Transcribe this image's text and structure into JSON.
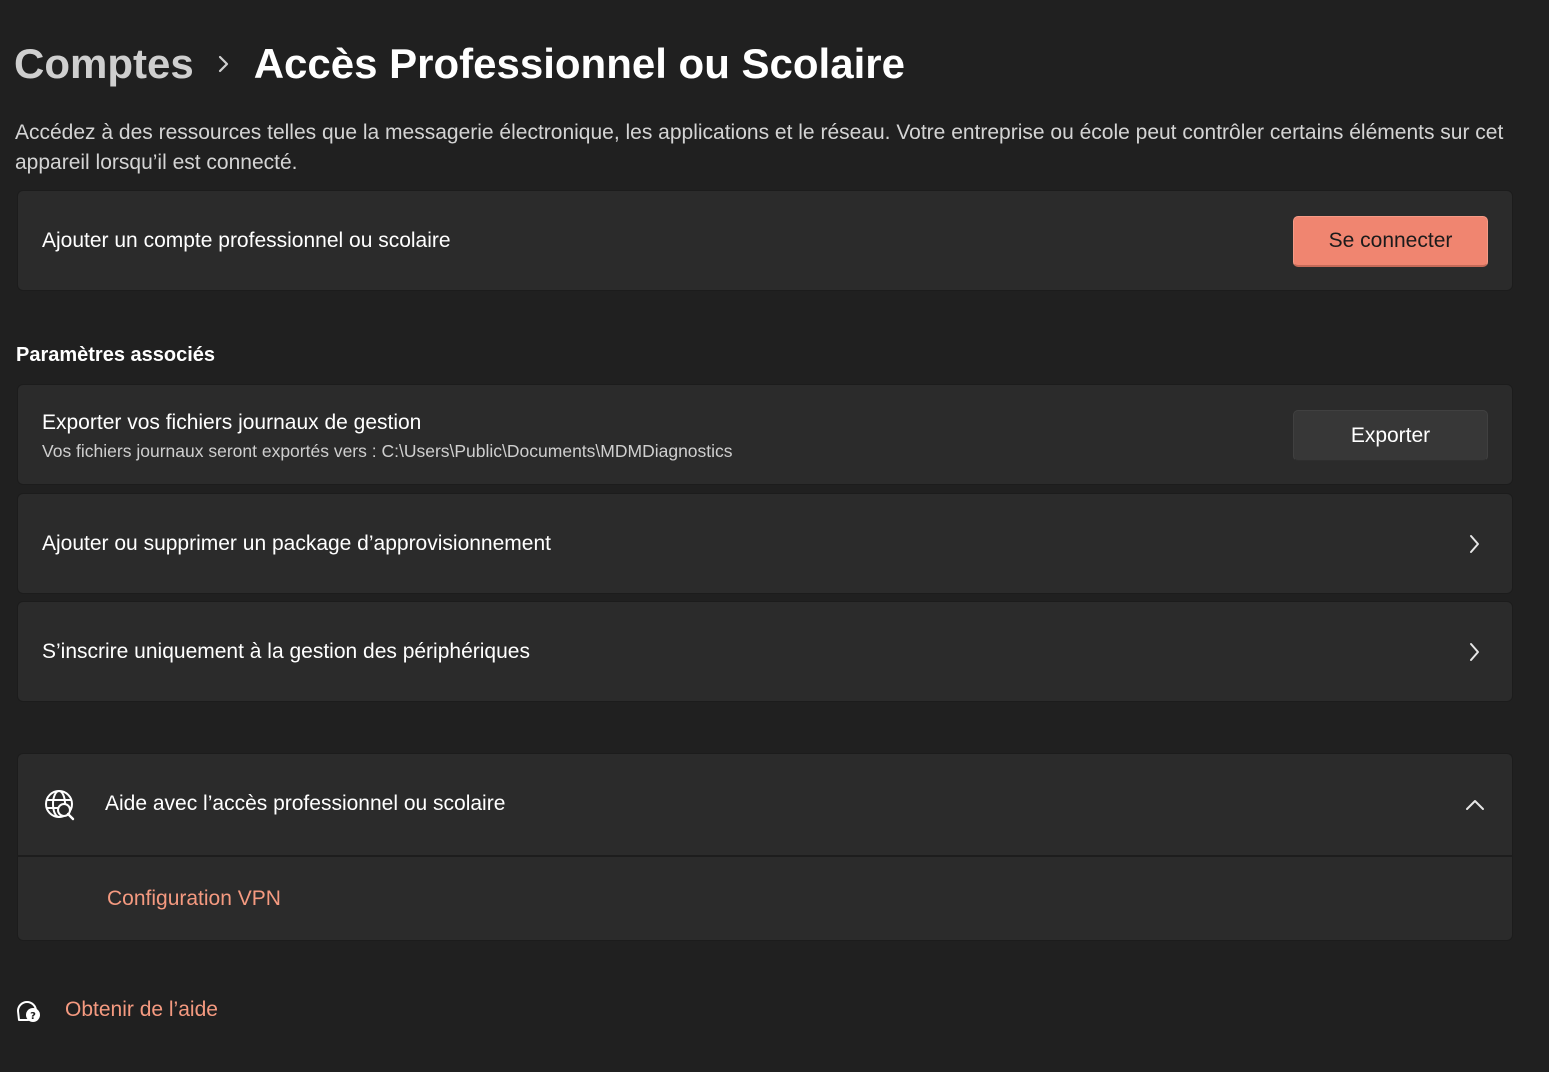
{
  "breadcrumb": {
    "parent": "Comptes",
    "separator_icon": "chevron-right-icon",
    "current": "Accès Professionnel ou Scolaire"
  },
  "description": "Accédez à des ressources telles que la messagerie électronique, les applications et le réseau. Votre entreprise ou école peut contrôler certains éléments sur cet appareil lorsqu’il est connecté.",
  "add_account": {
    "label": "Ajouter un compte professionnel ou scolaire",
    "button": "Se connecter"
  },
  "related": {
    "title": "Paramètres associés",
    "export": {
      "title": "Exporter vos fichiers journaux de gestion",
      "subtitle": "Vos fichiers journaux seront exportés vers : C:\\Users\\Public\\Documents\\MDMDiagnostics",
      "button": "Exporter"
    },
    "package": {
      "label": "Ajouter ou supprimer un package d’approvisionnement",
      "icon": "chevron-right-icon"
    },
    "enroll": {
      "label": "S’inscrire uniquement à la gestion des périphériques",
      "icon": "chevron-right-icon"
    }
  },
  "help": {
    "icon": "globe-search-icon",
    "title": "Aide avec l’accès professionnel ou scolaire",
    "expand_icon": "chevron-up-icon",
    "links": [
      "Configuration VPN"
    ]
  },
  "footer": {
    "icon": "help-chat-icon",
    "link": "Obtenir de l’aide"
  },
  "colors": {
    "background": "#202020",
    "card": "#2b2b2b",
    "accent_button": "#f08570",
    "link": "#f59a80"
  }
}
